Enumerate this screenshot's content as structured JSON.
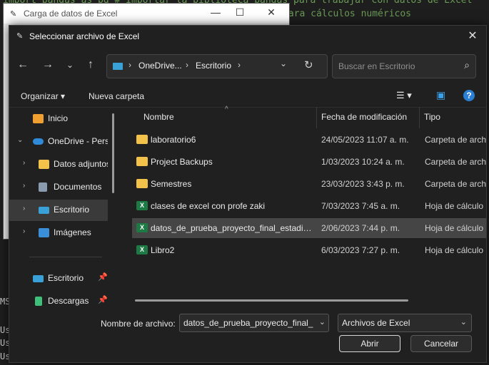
{
  "background": {
    "code_line_1": "import pandas as pd  # Importar la biblioteca pandas para trabajar con datos de Excel",
    "code_line_2": "para cálculos numéricos",
    "terminal_prefix": "Us",
    "terminal_prefix_ms": "MS"
  },
  "back_window": {
    "title": "Carga de datos de Excel",
    "minimize": "—",
    "maximize": "☐",
    "close": "✕"
  },
  "dialog": {
    "title": "Seleccionar archivo de Excel",
    "close_glyph": "✕",
    "back_glyph": "←",
    "forward_glyph": "→",
    "recent_glyph": "⌄",
    "up_glyph": "↑",
    "address": {
      "segments": [
        "OneDrive...",
        "Escritorio"
      ],
      "sep": "›",
      "dropdown": "⌄",
      "refresh": "↻"
    },
    "search": {
      "placeholder": "Buscar en Escritorio",
      "icon": "⌕"
    },
    "toolbar": {
      "organize": "Organizar ▾",
      "new_folder": "Nueva carpeta",
      "view": "☰ ▾",
      "preview": "▣",
      "help": "?"
    },
    "nav": [
      {
        "label": "Inicio",
        "icon": "home-icon",
        "arrow": "",
        "color": "#f0a030"
      },
      {
        "label": "OneDrive - Perso",
        "icon": "cloud-icon",
        "arrow": "⌄",
        "color": "#2f8ad8"
      },
      {
        "label": "Datos adjuntos",
        "icon": "folder-icon",
        "arrow": "›",
        "color": "#f2c24a"
      },
      {
        "label": "Documentos",
        "icon": "document-icon",
        "arrow": "›",
        "color": "#8a9bb0"
      },
      {
        "label": "Escritorio",
        "icon": "desktop-icon",
        "arrow": "›",
        "color": "#3aa0d8"
      },
      {
        "label": "Imágenes",
        "icon": "image-icon",
        "arrow": "›",
        "color": "#3a8fd8"
      },
      {
        "label": "Escritorio",
        "icon": "desktop-icon",
        "arrow": "",
        "color": "#3aa0d8",
        "pin": "📌"
      },
      {
        "label": "Descargas",
        "icon": "download-icon",
        "arrow": "",
        "color": "#3fc07a",
        "pin": "📌"
      }
    ],
    "columns": {
      "name": "Nombre",
      "date": "Fecha de modificación",
      "type": "Tipo",
      "sort_glyph": "^"
    },
    "files": [
      {
        "name": "laboratorio6",
        "date": "24/05/2023 11:07 a. m.",
        "type": "Carpeta de archi",
        "kind": "folder"
      },
      {
        "name": "Project Backups",
        "date": "1/03/2023 10:24 a. m.",
        "type": "Carpeta de archi",
        "kind": "folder"
      },
      {
        "name": "Semestres",
        "date": "23/03/2023 3:43 p. m.",
        "type": "Carpeta de archi",
        "kind": "folder"
      },
      {
        "name": "clases de excel con profe zaki",
        "date": "7/03/2023 7:45 a. m.",
        "type": "Hoja de cálculo",
        "kind": "xls"
      },
      {
        "name": "datos_de_prueba_proyecto_final_estadisti...",
        "date": "2/06/2023 7:44 p. m.",
        "type": "Hoja de cálculo",
        "kind": "xls",
        "selected": true
      },
      {
        "name": "Libro2",
        "date": "6/03/2023 7:27 p. m.",
        "type": "Hoja de cálculo",
        "kind": "xls"
      }
    ],
    "filename_label": "Nombre de archivo:",
    "filename_value": "datos_de_prueba_proyecto_final_estadistica",
    "filetype_value": "Archivos de Excel",
    "open_label": "Abrir",
    "cancel_label": "Cancelar",
    "xls_glyph": "X"
  }
}
